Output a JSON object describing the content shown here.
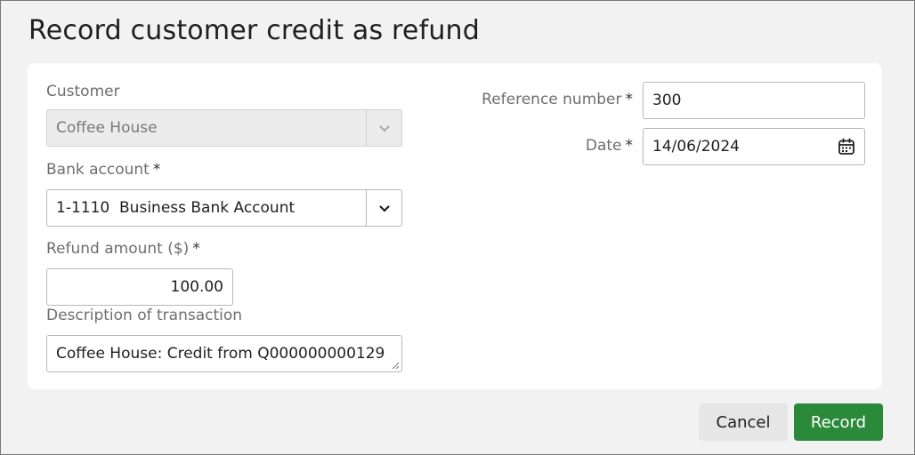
{
  "dialog": {
    "title": "Record customer credit as refund"
  },
  "form": {
    "customer": {
      "label": "Customer",
      "value": "Coffee House"
    },
    "bank_account": {
      "label": "Bank account",
      "required_mark": "*",
      "value": "1-1110  Business Bank Account"
    },
    "refund_amount": {
      "label": "Refund amount ($)",
      "required_mark": "*",
      "value": "100.00"
    },
    "description": {
      "label": "Description of transaction",
      "value": "Coffee House: Credit from Q000000000129"
    },
    "reference_number": {
      "label": "Reference number",
      "required_mark": "*",
      "value": "300"
    },
    "date": {
      "label": "Date",
      "required_mark": "*",
      "value": "14/06/2024"
    }
  },
  "actions": {
    "cancel_label": "Cancel",
    "record_label": "Record"
  },
  "colors": {
    "record_button": "#2a8a3a",
    "cancel_button": "#e6e6e6",
    "dialog_background": "#f2f2f2"
  },
  "icons": {
    "customer_select": "chevron-down-icon",
    "bank_select": "chevron-down-icon",
    "date_picker": "calendar-icon",
    "description_resize": "resize-grip-icon"
  }
}
